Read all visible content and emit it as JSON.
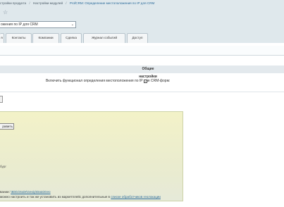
{
  "breadcrumbs": [
    {
      "label": "стройки продукта",
      "link": false
    },
    {
      "label": "Настройки модулей",
      "link": false
    },
    {
      "label": "ProfCRM: Определение местоположения по IP для CRM",
      "link": true
    }
  ],
  "star_icon": "star-icon",
  "module_select": {
    "value": "ожения по IP для CRM"
  },
  "tabs": [
    "я",
    "Контакты",
    "Компании",
    "Сделка",
    "Журнал событий",
    "Доступ"
  ],
  "section": {
    "title": "Общие настройки"
  },
  "option": {
    "label": "Включить функционал определения местоположения по IP для CRM-форм:",
    "checked": "✓"
  },
  "note": {
    "apply_button": "равить",
    "fragment": "бург",
    "line1_prefix": "вании:",
    "line1_link": "\\Bitrix\\Sale\\Geoip\\Data\\Geo",
    "line2_prefix": "можно настроить и так же установить из маркетплейс дополнительные в",
    "line2_link": "списке обработчиков геолокации"
  }
}
